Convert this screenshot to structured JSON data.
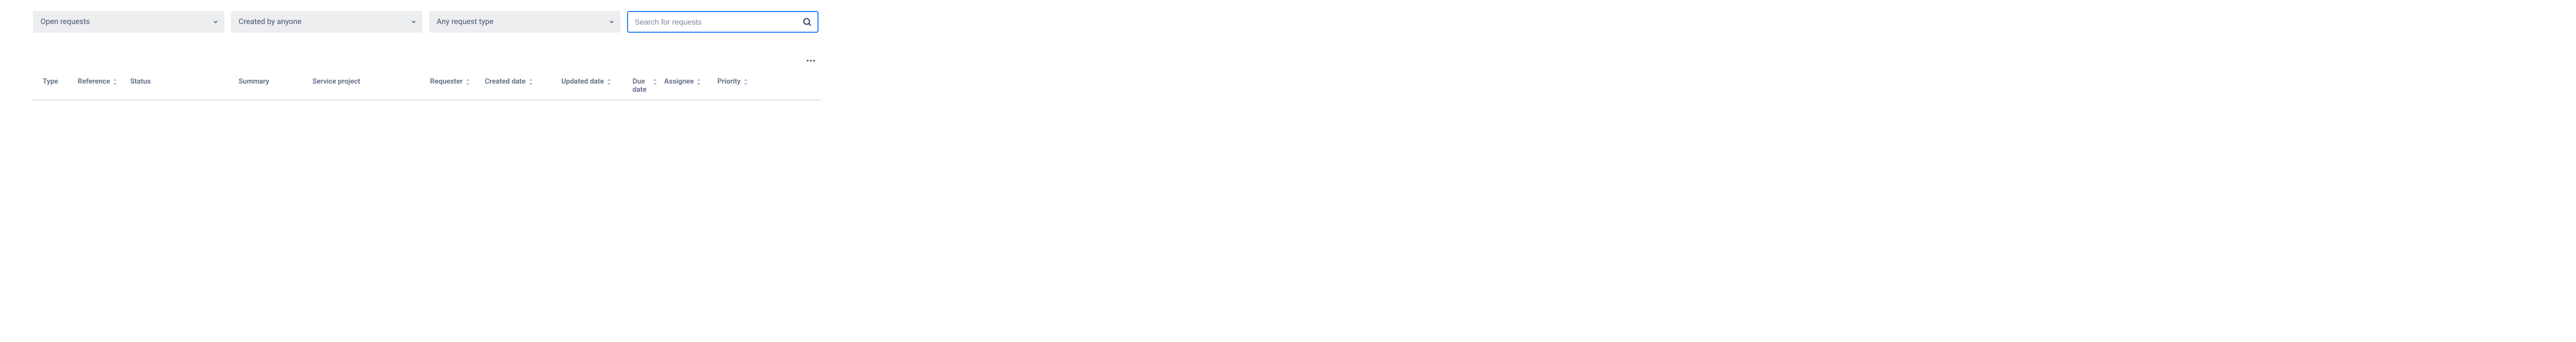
{
  "filters": {
    "status": "Open requests",
    "creator": "Created by anyone",
    "request_type": "Any request type"
  },
  "search": {
    "placeholder": "Search for requests",
    "value": ""
  },
  "columns": {
    "type": "Type",
    "reference": "Reference",
    "status": "Status",
    "summary": "Summary",
    "service_project": "Service project",
    "requester": "Requester",
    "created_date": "Created date",
    "updated_date": "Updated date",
    "due_date": "Due date",
    "assignee": "Assignee",
    "priority": "Priority"
  }
}
